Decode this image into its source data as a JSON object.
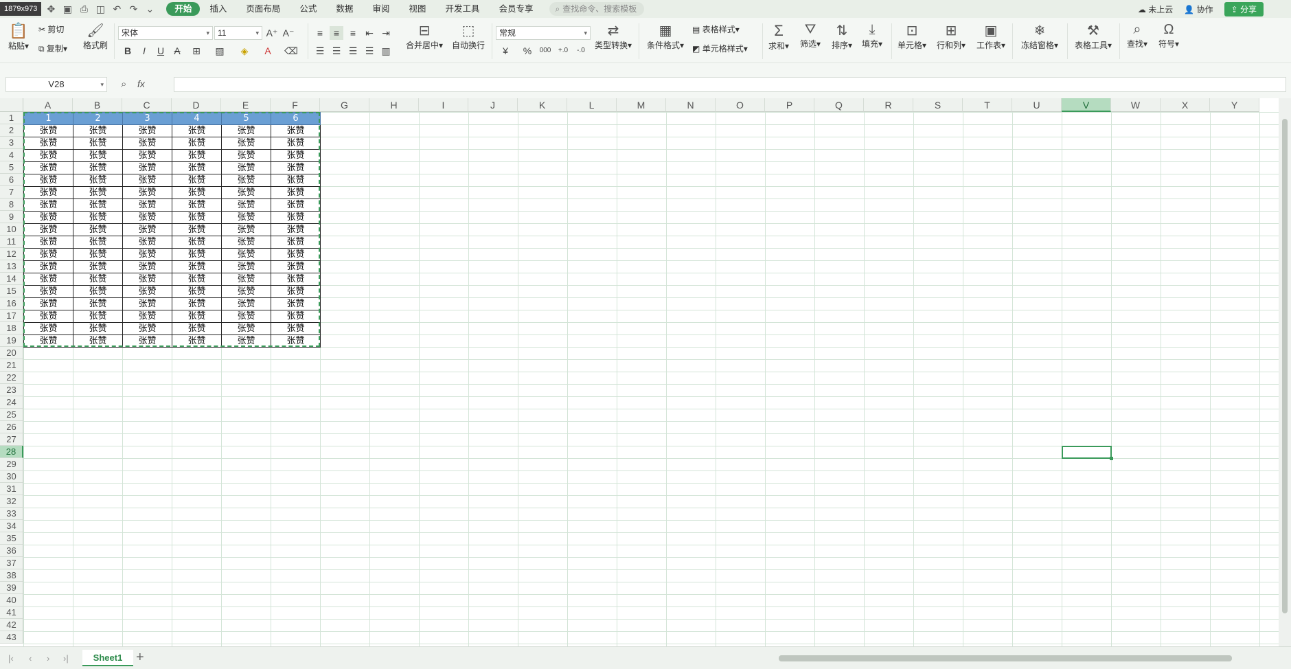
{
  "window": {
    "dimensions_label": "1879x973"
  },
  "menu": {
    "items": [
      "开始",
      "插入",
      "页面布局",
      "公式",
      "数据",
      "审阅",
      "视图",
      "开发工具",
      "会员专享"
    ],
    "active_index": 0
  },
  "search": {
    "placeholder": "查找命令、搜索模板"
  },
  "topright": {
    "cloud": "未上云",
    "collab": "协作",
    "share": "分享"
  },
  "ribbon": {
    "paste": "粘贴",
    "cut": "剪切",
    "copy": "复制",
    "format_painter": "格式刷",
    "font_name": "宋体",
    "font_size": "11",
    "merge_center": "合并居中",
    "wrap_text": "自动换行",
    "number_format": "常规",
    "type_convert": "类型转换",
    "conditional_format": "条件格式",
    "table_style": "表格样式",
    "cell_style": "单元格样式",
    "sum": "求和",
    "filter": "筛选",
    "sort": "排序",
    "fill": "填充",
    "cell": "单元格",
    "row_col": "行和列",
    "worksheet": "工作表",
    "freeze": "冻结窗格",
    "table_tools": "表格工具",
    "find": "查找",
    "symbol": "符号",
    "currency_symbol": "¥",
    "percent_symbol": "%",
    "thousands_symbol": "000",
    "decimal_inc": "+.0",
    "decimal_dec": "-.0"
  },
  "formula_bar": {
    "name_box": "V28",
    "fx_label": "fx",
    "value": ""
  },
  "columns": [
    "A",
    "B",
    "C",
    "D",
    "E",
    "F",
    "G",
    "H",
    "I",
    "J",
    "K",
    "L",
    "M",
    "N",
    "O",
    "P",
    "Q",
    "R",
    "S",
    "T",
    "U",
    "V",
    "W",
    "X",
    "Y"
  ],
  "selected_column": "V",
  "selected_row": 28,
  "rows": [
    "1",
    "2",
    "3",
    "4",
    "5",
    "6",
    "7",
    "8",
    "9",
    "10",
    "11",
    "12",
    "13",
    "14",
    "15",
    "16",
    "17",
    "18",
    "19",
    "20",
    "21",
    "22",
    "23",
    "24",
    "25",
    "26",
    "27",
    "28",
    "29",
    "30",
    "31",
    "32",
    "33",
    "34",
    "35",
    "36",
    "37",
    "38",
    "39",
    "40",
    "41",
    "42",
    "43"
  ],
  "table": {
    "header": [
      "1",
      "2",
      "3",
      "4",
      "5",
      "6"
    ],
    "cell_value": "张赞",
    "data_rows": 18
  },
  "sheets": [
    "Sheet1"
  ],
  "colors": {
    "accent": "#3a9a5a",
    "header_fill": "#6a9fd4",
    "grid_line": "#d3e4d7"
  }
}
